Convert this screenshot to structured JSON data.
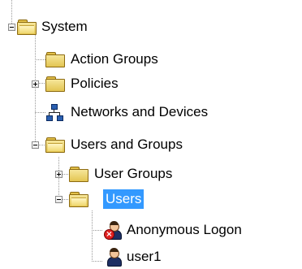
{
  "tree": {
    "system": {
      "label": "System"
    },
    "action_groups": {
      "label": "Action Groups"
    },
    "policies": {
      "label": "Policies"
    },
    "networks_and_devices": {
      "label": "Networks and Devices"
    },
    "users_and_groups": {
      "label": "Users and Groups"
    },
    "user_groups": {
      "label": "User Groups"
    },
    "users": {
      "label": "Users",
      "selected": true
    },
    "anonymous_logon": {
      "label": "Anonymous Logon",
      "status": "disabled"
    },
    "user1": {
      "label": "user1"
    }
  },
  "icons": {
    "folder": "folder-icon",
    "network": "network-icon",
    "user": "user-icon",
    "disabled_user": "disabled-user-icon"
  },
  "colors": {
    "selection": "#3399ff",
    "folder": "#e3c552",
    "error_badge": "#e02020"
  }
}
